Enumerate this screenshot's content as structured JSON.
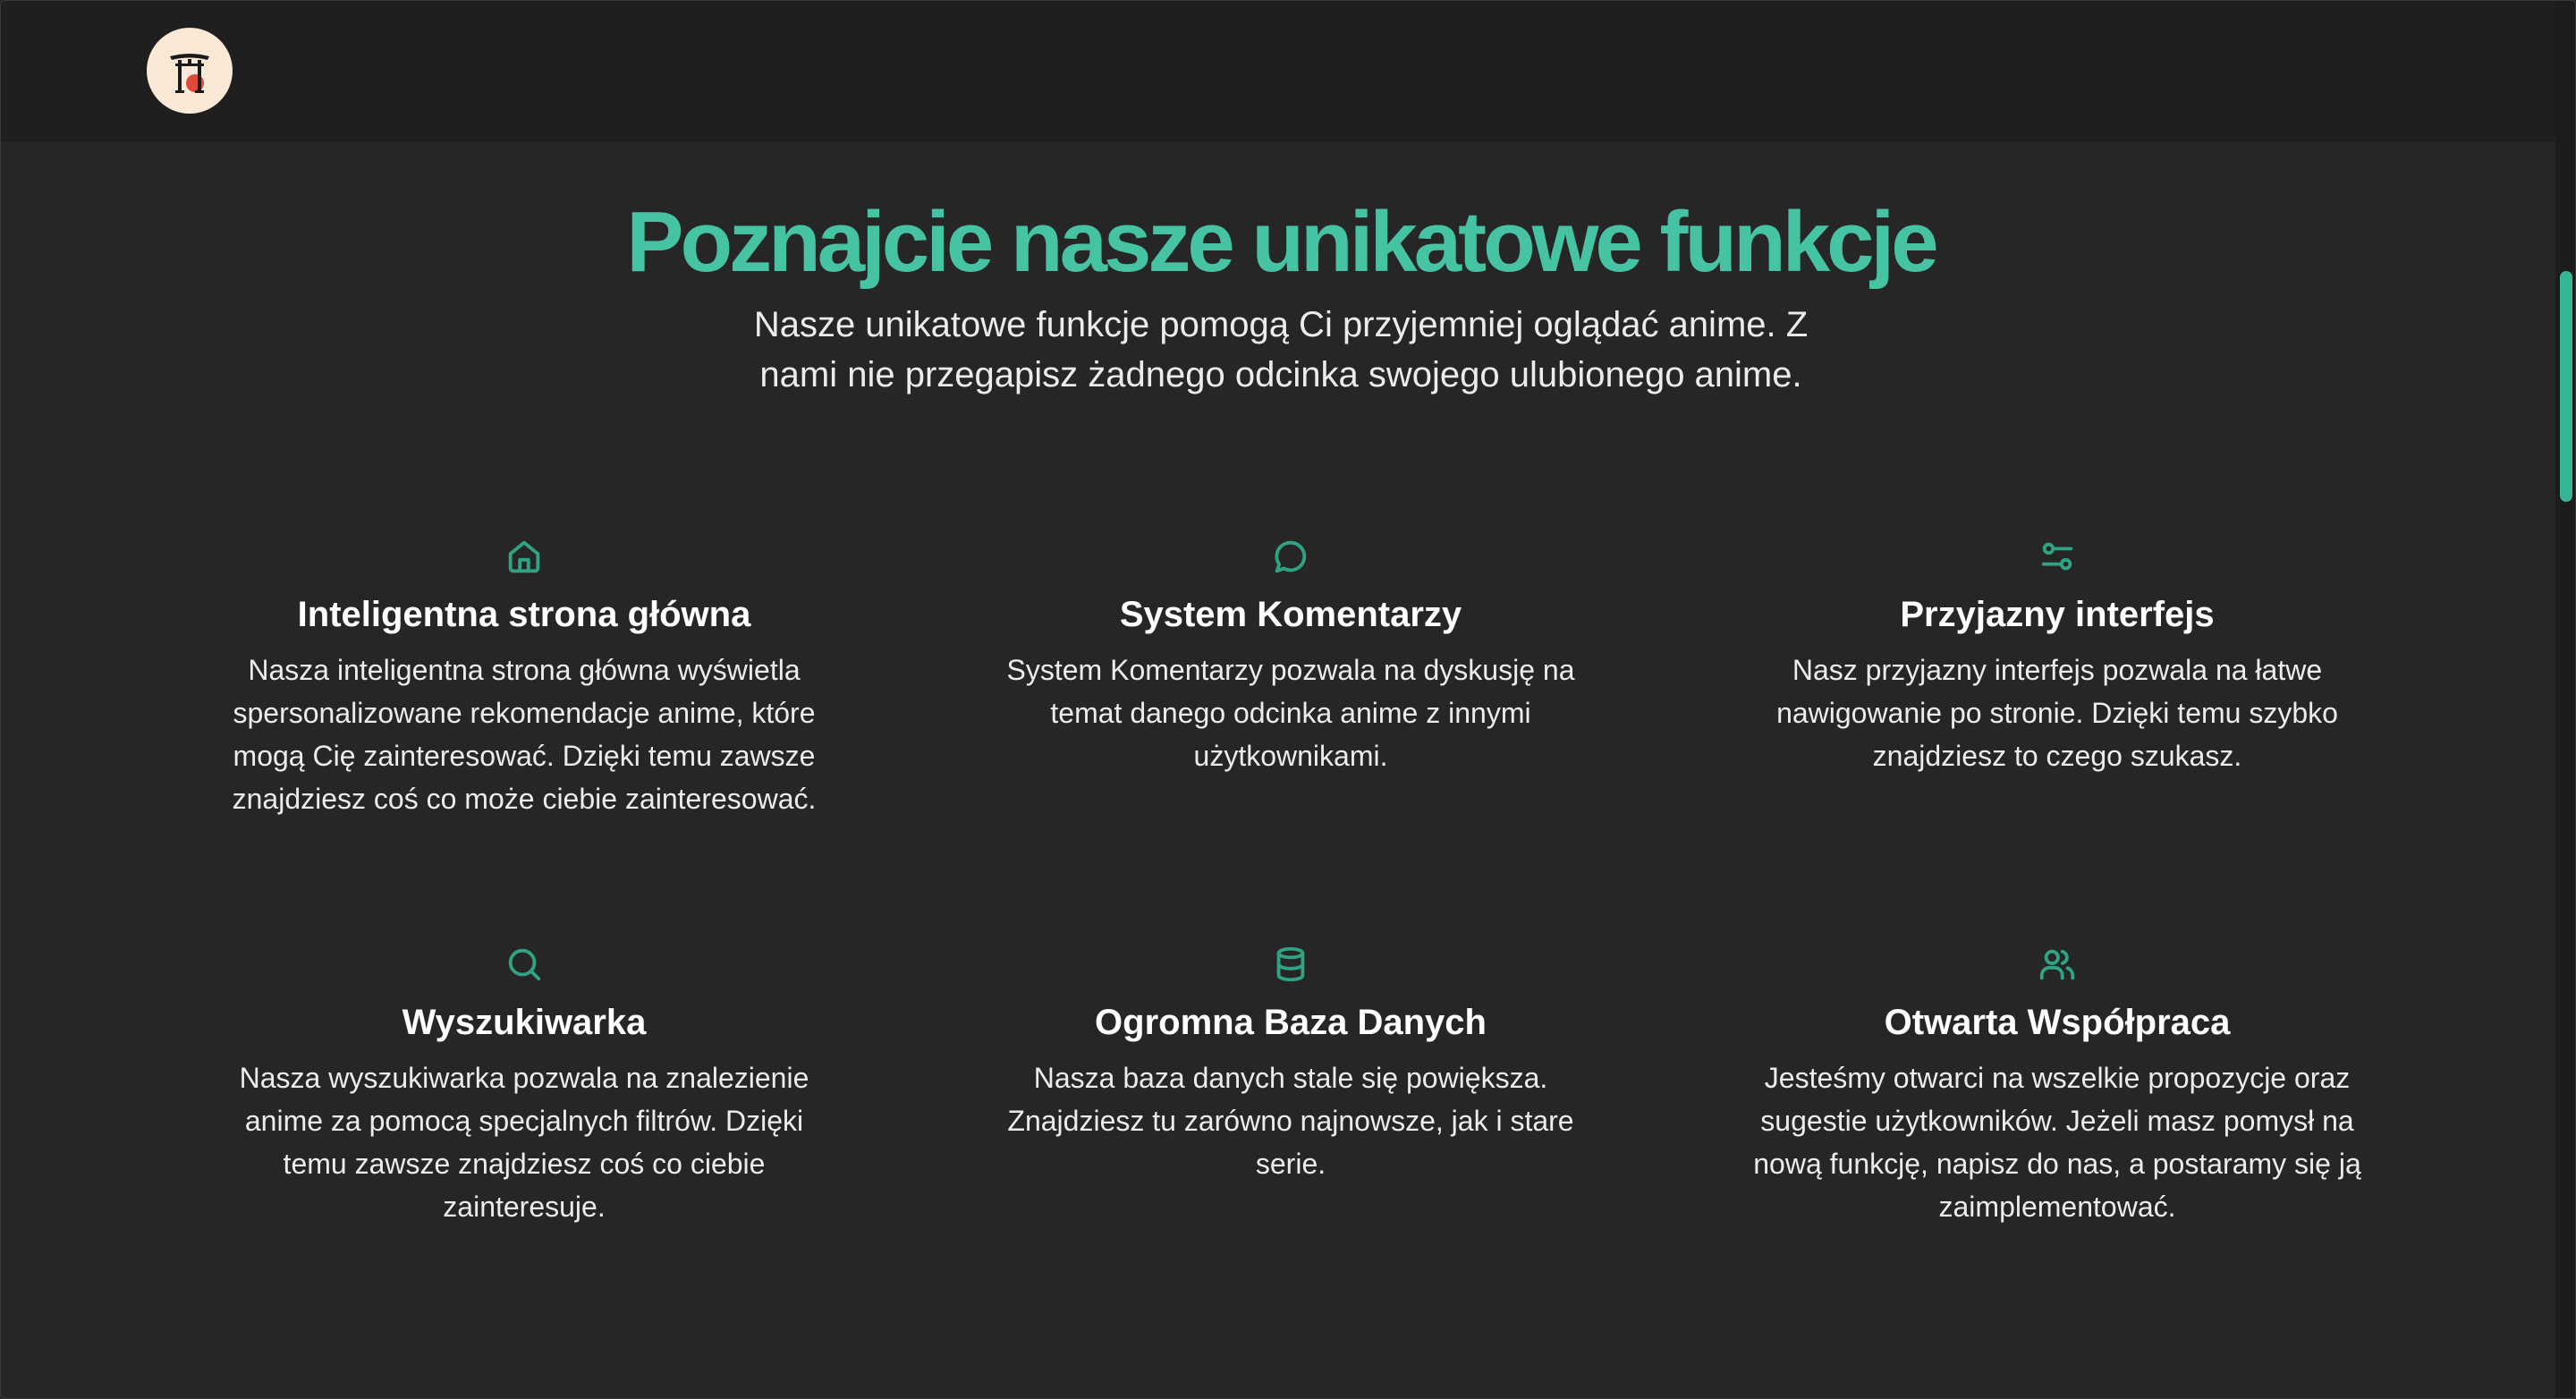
{
  "header": {
    "logo_icon": "torii-gate-logo-icon"
  },
  "hero": {
    "title": "Poznajcie nasze unikatowe funkcje",
    "subtitle": "Nasze unikatowe funkcje pomogą Ci przyjemniej oglądać anime. Z nami nie przegapisz żadnego odcinka swojego ulubionego anime."
  },
  "colors": {
    "accent": "#45c3a2",
    "icon": "#2fa383",
    "background": "#262626",
    "header_background": "#1f1f1f",
    "logo_background": "#fbe9d7"
  },
  "features": [
    {
      "icon": "home-icon",
      "title": "Inteligentna strona główna",
      "description": "Nasza inteligentna strona główna wyświetla spersonalizowane rekomendacje anime, które mogą Cię zainteresować. Dzięki temu zawsze znajdziesz coś co może ciebie zainteresować."
    },
    {
      "icon": "comment-icon",
      "title": "System Komentarzy",
      "description": "System Komentarzy pozwala na dyskusję na temat danego odcinka anime z innymi użytkownikami."
    },
    {
      "icon": "sliders-icon",
      "title": "Przyjazny interfejs",
      "description": "Nasz przyjazny interfejs pozwala na łatwe nawigowanie po stronie. Dzięki temu szybko znajdziesz to czego szukasz."
    },
    {
      "icon": "search-icon",
      "title": "Wyszukiwarka",
      "description": "Nasza wyszukiwarka pozwala na znalezienie anime za pomocą specjalnych filtrów. Dzięki temu zawsze znajdziesz coś co ciebie zainteresuje."
    },
    {
      "icon": "database-icon",
      "title": "Ogromna Baza Danych",
      "description": "Nasza baza danych stale się powiększa. Znajdziesz tu zarówno najnowsze, jak i stare serie."
    },
    {
      "icon": "users-icon",
      "title": "Otwarta Współpraca",
      "description": "Jesteśmy otwarci na wszelkie propozycje oraz sugestie użytkowników. Jeżeli masz pomysł na nową funkcję, napisz do nas, a postaramy się ją zaimplementować."
    }
  ]
}
